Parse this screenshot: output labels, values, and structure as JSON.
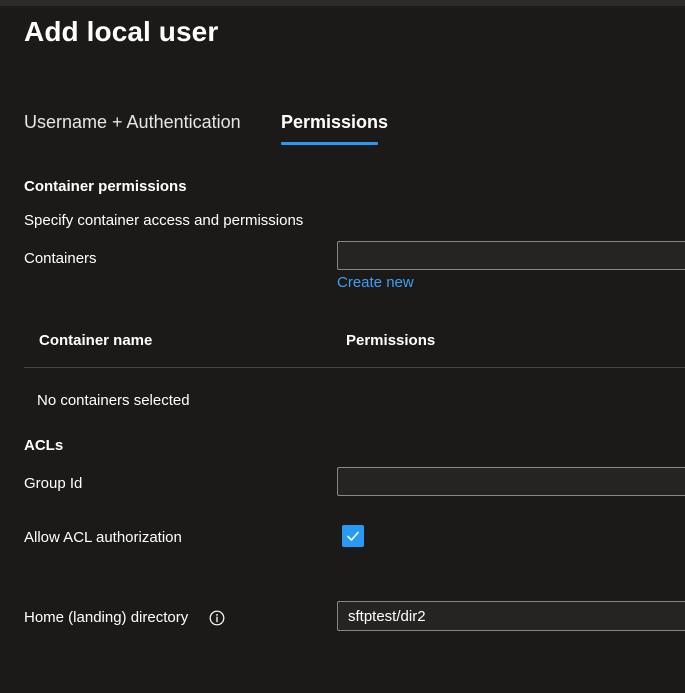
{
  "header": {
    "title": "Add local user"
  },
  "tabs": [
    {
      "label": "Username + Authentication",
      "selected": false
    },
    {
      "label": "Permissions",
      "selected": true
    }
  ],
  "container_permissions": {
    "heading": "Container permissions",
    "description": "Specify container access and permissions",
    "containers_label": "Containers",
    "containers_value": "",
    "create_new_label": "Create new"
  },
  "table": {
    "columns": [
      "Container name",
      "Permissions"
    ],
    "empty_text": "No containers selected"
  },
  "acls": {
    "heading": "ACLs",
    "group_id_label": "Group Id",
    "group_id_value": "",
    "allow_acl_label": "Allow ACL authorization",
    "allow_acl_checked": true
  },
  "home_directory": {
    "label": "Home (landing) directory",
    "value": "sftptest/dir2"
  },
  "colors": {
    "background": "#1b1a19",
    "accent": "#2899f5",
    "link": "#3aa0f3",
    "input_background": "#252423",
    "input_border": "#8a8886"
  }
}
